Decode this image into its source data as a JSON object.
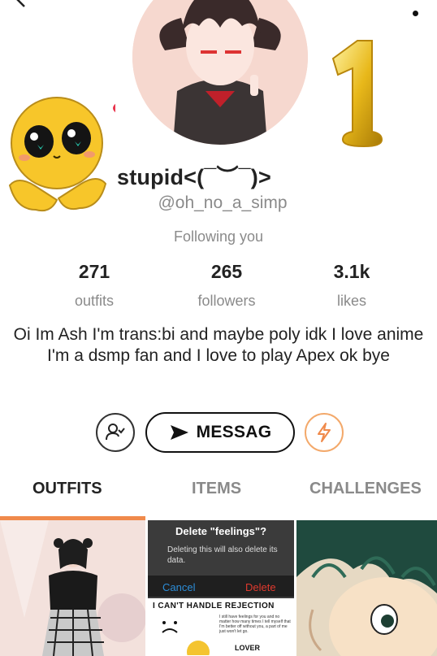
{
  "profile": {
    "display_name": "stupid<(¯︶¯)>",
    "handle": "@oh_no_a_simp",
    "relation": "Following you",
    "bio": "Oi Im Ash I'm trans:bi and maybe poly idk I love anime I'm a dsmp fan and I love to play Apex ok bye"
  },
  "stats": {
    "outfits": {
      "value": "271",
      "label": "outfits"
    },
    "followers": {
      "value": "265",
      "label": "followers"
    },
    "likes": {
      "value": "3.1k",
      "label": "likes"
    }
  },
  "actions": {
    "message_label": "MESSAG",
    "follow_icon": "user-check-icon",
    "boost_icon": "lightning-icon",
    "accent_orange": "#f08a4b"
  },
  "tabs": [
    {
      "label": "OUTFITS",
      "active": true
    },
    {
      "label": "ITEMS",
      "active": false
    },
    {
      "label": "CHALLENGES",
      "active": false
    }
  ],
  "thumbnails": {
    "meme": {
      "dialog_title": "Delete \"feelings\"?",
      "dialog_body": "Deleting this will also delete its data.",
      "cancel": "Cancel",
      "delete": "Delete",
      "headline": "I CAN'T HANDLE REJECTION",
      "note": "I still have feelings for you and no matter how many times I tell myself that I'm better off without you, a part of me just won't let go.",
      "stamp": "LOVER"
    }
  }
}
